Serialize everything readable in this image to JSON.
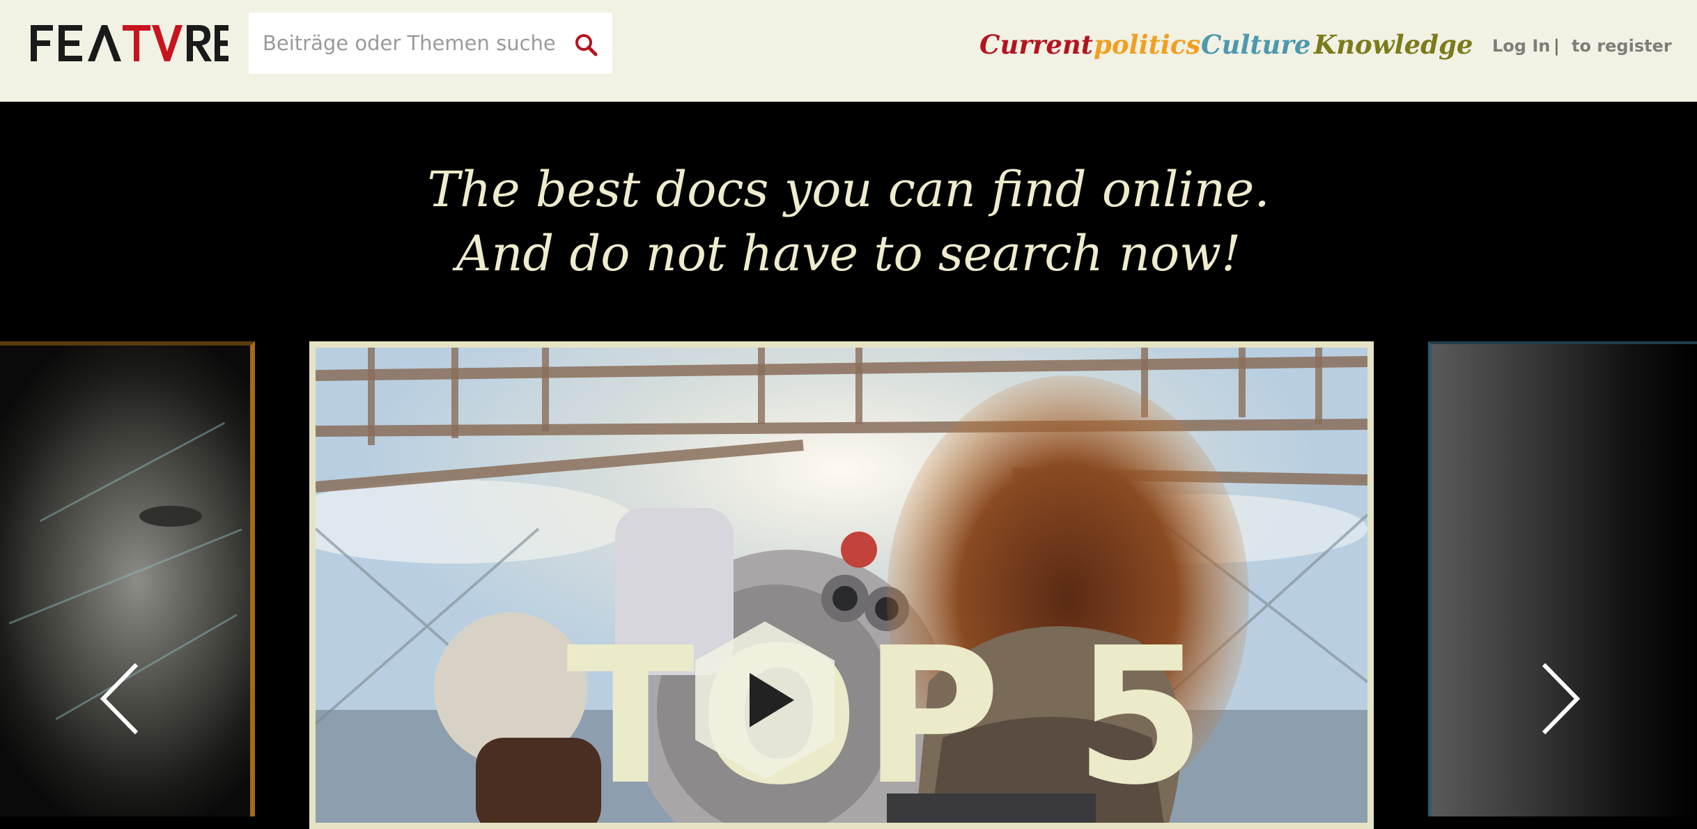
{
  "brand": {
    "logo_text": "FEATVRE"
  },
  "search": {
    "placeholder": "Beiträge oder Themen suchen",
    "icon": "search-icon"
  },
  "nav": {
    "items": [
      {
        "label": "Current",
        "color": "#b4141e"
      },
      {
        "label": "politics",
        "color": "#f0a020"
      },
      {
        "label": "Culture",
        "color": "#4e98ad"
      },
      {
        "label": "Knowledge",
        "color": "#7b7b1d"
      }
    ]
  },
  "auth": {
    "login_label": "Log In",
    "separator": "|",
    "register_label": "to register"
  },
  "hero": {
    "line1": "The best docs you can find online.",
    "line2": "And do not have to search now!"
  },
  "carousel": {
    "featured_title": "TOP 5",
    "play_icon": "play-icon",
    "prev_icon": "chevron-left-icon",
    "next_icon": "chevron-right-icon"
  },
  "colors": {
    "header_bg": "#f1f1e4",
    "page_bg": "#000000",
    "accent_cream": "#ecebc9",
    "search_icon": "#b4141e"
  }
}
